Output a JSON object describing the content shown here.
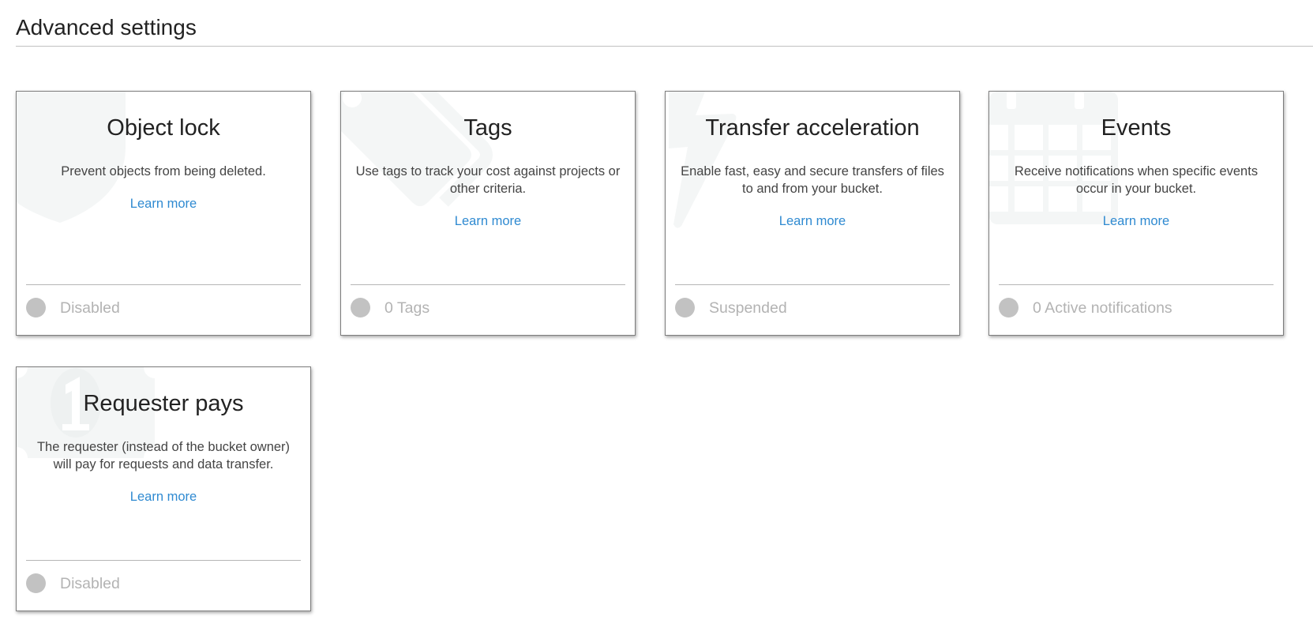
{
  "section": {
    "title": "Advanced settings"
  },
  "colors": {
    "link": "#2f8ad1",
    "status_dot": "#c2c2c2",
    "status_text": "#b3b3b3",
    "card_border": "#7d7d7d",
    "watermark": "#f4f6f6"
  },
  "cards": [
    {
      "title": "Object lock",
      "description": "Prevent objects from being deleted.",
      "link": "Learn more",
      "status": "Disabled",
      "icon": "shield-icon"
    },
    {
      "title": "Tags",
      "description": "Use tags to track your cost against projects or other criteria.",
      "link": "Learn more",
      "status": "0 Tags",
      "icon": "tag-icon"
    },
    {
      "title": "Transfer acceleration",
      "description": "Enable fast, easy and secure transfers of files to and from your bucket.",
      "link": "Learn more",
      "status": "Suspended",
      "icon": "lightning-icon"
    },
    {
      "title": "Events",
      "description": "Receive notifications when specific events occur in your bucket.",
      "link": "Learn more",
      "status": "0 Active notifications",
      "icon": "calendar-icon"
    },
    {
      "title": "Requester pays",
      "description": "The requester (instead of the bucket owner) will pay for requests and data transfer.",
      "link": "Learn more",
      "status": "Disabled",
      "icon": "dollar-bill-icon"
    }
  ]
}
